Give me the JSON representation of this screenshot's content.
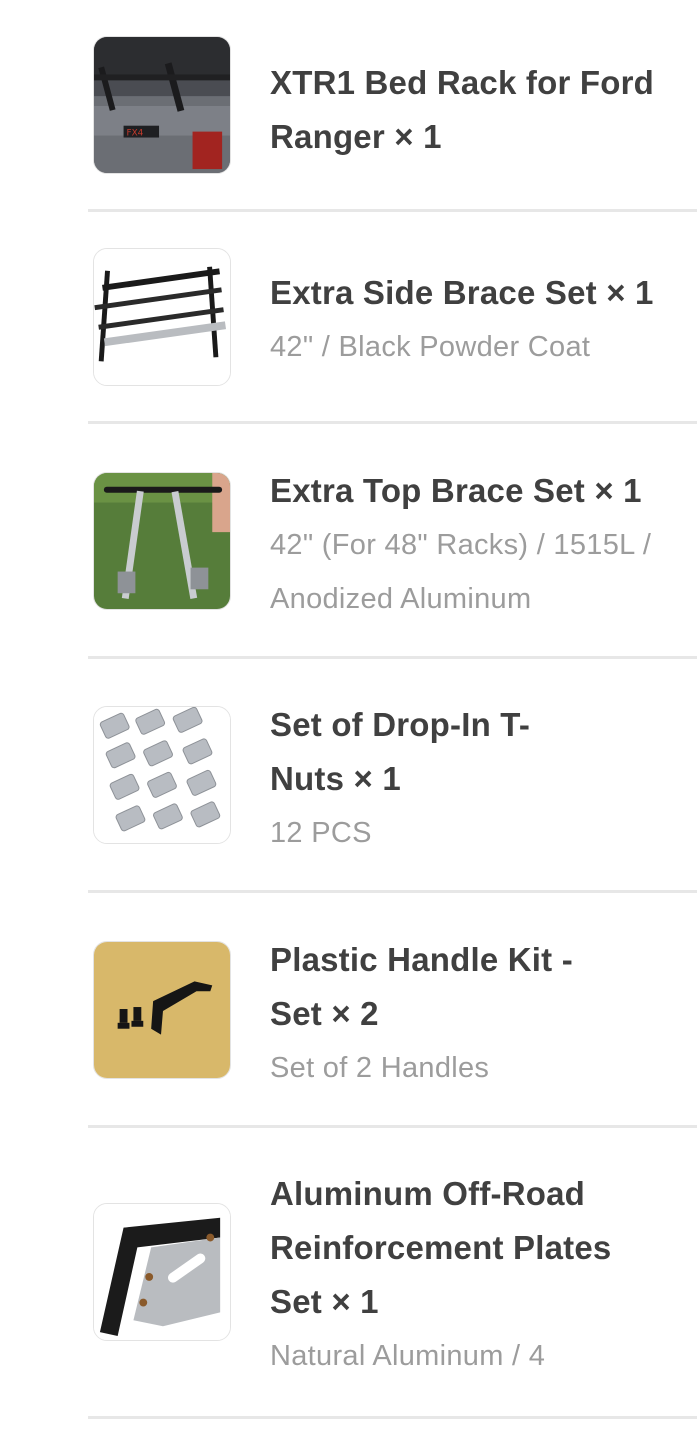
{
  "cart_items": [
    {
      "title_lines": [
        "XTR1 Bed Rack for Ford",
        "Ranger × 1"
      ],
      "variant_lines": [],
      "image_icon": "truck-bed-rack-photo"
    },
    {
      "title_lines": [
        "Extra Side Brace Set × 1"
      ],
      "variant_lines": [
        "42\" / Black Powder Coat"
      ],
      "image_icon": "side-brace-photo"
    },
    {
      "title_lines": [
        "Extra Top Brace Set × 1"
      ],
      "variant_lines": [
        "42\" (For 48\" Racks) / 1515L /",
        "Anodized Aluminum"
      ],
      "image_icon": "top-brace-photo"
    },
    {
      "title_lines": [
        "Set of Drop-In T-",
        "Nuts × 1"
      ],
      "variant_lines": [
        "12 PCS"
      ],
      "image_icon": "t-nuts-photo"
    },
    {
      "title_lines": [
        "Plastic Handle Kit -",
        "Set × 2"
      ],
      "variant_lines": [
        "Set of 2 Handles"
      ],
      "image_icon": "handle-kit-photo"
    },
    {
      "title_lines": [
        "Aluminum Off-Road",
        "Reinforcement Plates",
        "Set × 1"
      ],
      "variant_lines": [
        "Natural Aluminum / 4"
      ],
      "image_icon": "reinforcement-plate-photo"
    }
  ]
}
